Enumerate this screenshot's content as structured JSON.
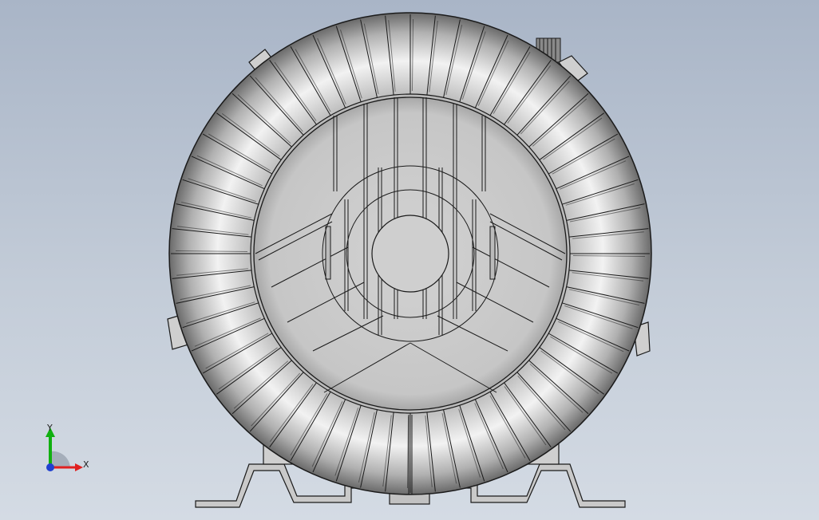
{
  "app": {
    "view": "Front"
  },
  "triad": {
    "x_label": "X",
    "y_label": "Y"
  },
  "colors": {
    "background_top": "#a9b5c7",
    "background_bottom": "#d4dbe4",
    "model_edge": "#1a1a1a",
    "model_face": "#c8c8c8",
    "x_axis": "#e02020",
    "y_axis": "#10b010",
    "z_axis": "#2040d0"
  },
  "icons": [
    "coordinate-triad-icon"
  ]
}
